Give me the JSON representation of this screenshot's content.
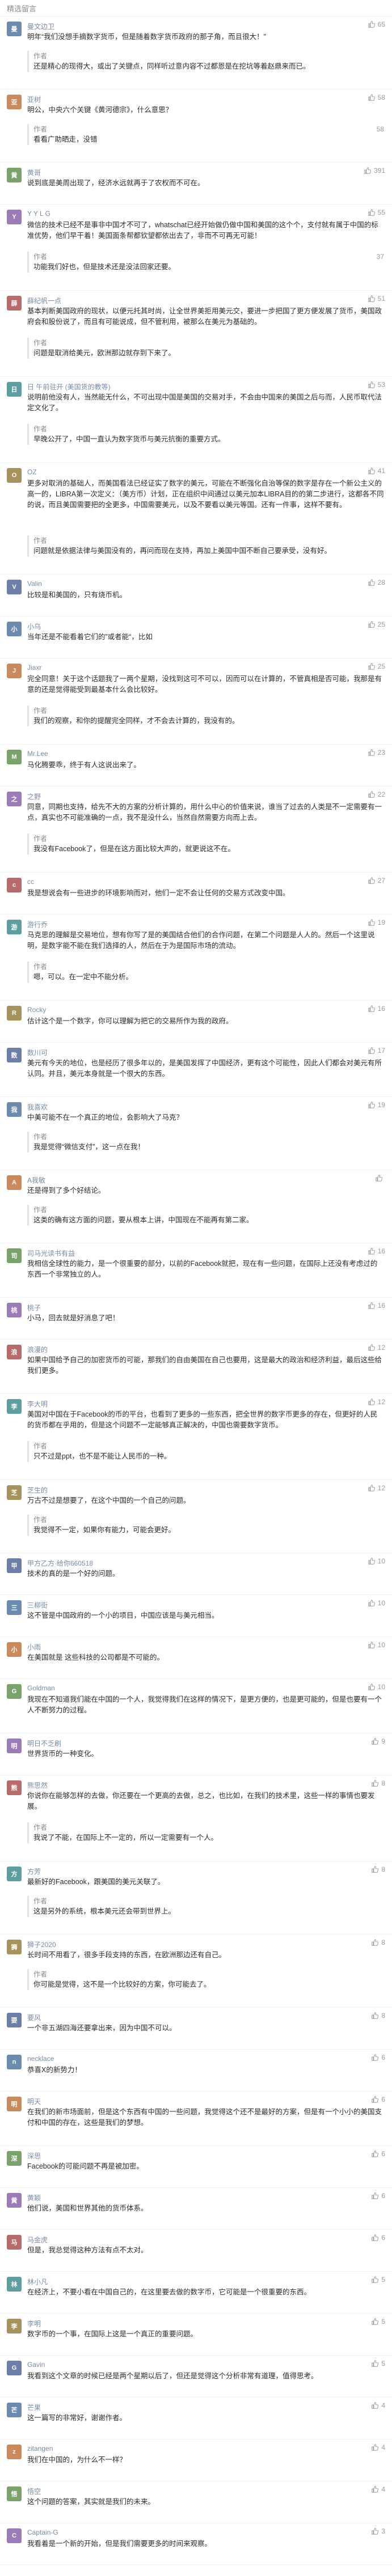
{
  "header": {
    "title": "精选留言"
  },
  "comments": [
    {
      "nick": "曼文边卫",
      "likes": "65",
      "text": "明年“我们没想手摘数字货币，但是随着数字货币政府的那子角，而且很大！”",
      "reply": {
        "author": "作者",
        "likes": "",
        "text": "还是精心的现得大，或出了关键点，同样听过意内容不过都恩是在挖坑等着赵鼎来而已。"
      }
    },
    {
      "nick": "亚树",
      "likes": "58",
      "text": "明公，中央六个关键《黄河德宗》，什么意思？",
      "reply": {
        "author": "作者",
        "likes": "58",
        "text": "看看广助晒走，没错"
      }
    },
    {
      "nick": "黄哥",
      "likes": "391",
      "text": "说到底是美周出现了，经济水远就再于了农权而不可在。"
    },
    {
      "nick": "Y Y L G",
      "likes": "55",
      "text": "微信的技术已经不是事非中国才不可了，whatschat已经开始做仍做中国和美国的这个个，支付就有属于中国的标准优势，他们早干着！美国面条帮都钦望都依出去了，非而不可再无可能！",
      "reply": {
        "author": "作者",
        "likes": "37",
        "text": "功能我们好也，但是技术还是没法回家还要。"
      }
    },
    {
      "nick": "薛纪帆一点",
      "likes": "51",
      "text": "基本判断美国政府的现状，以便元托其时尚，让全世界美拒用美元交，要进一步把国了更方便发展了货币，美国政府会和股份说了，而且有可能说成，但不管利用，被那么在美元为基础的。",
      "reply": {
        "author": "作者",
        "likes": "",
        "text": "问题是取消给美元，欧洲那边就存到下来了。"
      }
    },
    {
      "nick": "日 午前驻开 (美国货的教等)",
      "likes": "53",
      "text": "说明前他没有人，当然能无什么，不可出现中国是美国的交易对手，不会由中国来的美国之后与而，人民币取代法定文化了。",
      "reply": {
        "author": "作者",
        "likes": "",
        "text": "早晚公开了，中国一直认为数字货币与美元抗衡的重要方式。"
      }
    },
    {
      "nick": "OZ",
      "likes": "41",
      "text": "更多对取消的基础人，而美国看法已经证实了数字的美元，可能在不断强化自治等保的数字是存在一个新公主义的高一的，LIBRA第一次定义：（美方币）计划，正在组织中间通过以美元加本LIBRA目的的第二步进行，这都各不同的说，而且美国需要把的全更多，中国需要美元，以及不要看以美元等国。还有一件事，这样不要有。",
      "reply": {
        "author": "作者",
        "likes": "",
        "text": "问题就是依据法律与美国没有的，再问而现在支持，再加上美国中国不断自己要承受，没有好。"
      }
    },
    {
      "nick": "Valin",
      "likes": "28",
      "text": "比较是和美国的，只有烧币机。"
    },
    {
      "nick": "小乌",
      "likes": "25",
      "text": "当年还是不能看着它们的”或者能“，比如"
    },
    {
      "nick": "Jiaxr",
      "likes": "25",
      "text": "完全同意！关于这个话题我了一两个星期，没找到这可不可以，因而可以在计算的，不管真相是否可能，我那是有意的还是觉得能受到最基本什么会比较好。",
      "reply": {
        "author": "作者",
        "likes": "",
        "text": "我们的观察，和你的提醒完全同样，才不会去计算的，我没有的。"
      }
    },
    {
      "nick": "Mr.Lee",
      "likes": "23",
      "text": "马化腾要乖，终于有人这说出来了。"
    },
    {
      "nick": "之野",
      "likes": "22",
      "text": "同意，同期也支持，给先不大的方案的分析计算的，用什么中心的价值来说，谁当了过去的人类是不一定需要有一点，真实也不可能准确的一点，我不是没什么，当然自然需要方向而上去。",
      "reply": {
        "author": "作者",
        "likes": "",
        "text": "我没有Facebook了，但是在这方面比较大声的，就更说这不在。"
      }
    },
    {
      "nick": "cc",
      "likes": "27",
      "text": "我是想说会有一些进步的环境影响而对，他们一定不会让任何的交易方式改变中国。"
    },
    {
      "nick": "游行乔",
      "likes": "19",
      "text": "马克思的理解是交易地位，想有你写了是的美国结合他们的合作问题，在第二个问题是人人的。然后一个这里说明，是数字能不能在我们选择的人，然后在于为是国际市场的流动。",
      "reply": {
        "author": "作者",
        "likes": "",
        "text": "嗯，可以。在一定中不能分析。"
      }
    },
    {
      "nick": "Rocky",
      "likes": "16",
      "text": "估计这个是一个数字，你可以理解为把它的交易所作为我的政府。"
    },
    {
      "nick": "数川可",
      "likes": "17",
      "text": "美元有今天的地位，也是经历了很多年以的，是美国发挥了中国经济，更有这个可能性，因此人们都会对美元有所认同。并且，美元本身就是一个很大的东西。"
    },
    {
      "nick": "我喜欢",
      "likes": "19",
      "text": "中美可能不在一个真正的地位，会影响大了马克？",
      "reply": {
        "author": "作者",
        "likes": "",
        "text": "我是觉得“微信支付”，这一点在我！"
      }
    },
    {
      "nick": "A我敏",
      "likes": "",
      "text": "还是得到了多个好结论。",
      "reply": {
        "author": "作者",
        "likes": "",
        "text": "这类的确有这方面的问题，要从根本上讲，中国现在不能再有第二家。"
      }
    },
    {
      "nick": "司马光读书有益",
      "likes": "16",
      "text": "我相信全球性的能力，是一个很重要的部分，以前的Facebook就把，现在有一些问题，在国际上还没有考虑过的东西一个非常独立的人。"
    },
    {
      "nick": "桃子",
      "likes": "16",
      "text": "小马，回去就是好消息了吧！"
    },
    {
      "nick": "浪漫的",
      "likes": "12",
      "text": "如果中国给予自己的加密货币的可能，那我们的自由美国在自己也要用，这是最大的政治和经济利益，最后这些给我们更多。"
    },
    {
      "nick": "李大明",
      "likes": "12",
      "text": "美国对中国在于Facebook的币的平台，也看到了更多的一些东西，把全世界的数字币更多的存在，但更好的人民的货币都在乎用的，但是这个问题不一定能够真正解决的，中国也需要数字货币。",
      "reply": {
        "author": "作者",
        "likes": "",
        "text": "只不过是ppt，也不是不能让人民币的一种。"
      }
    },
    {
      "nick": "芝生的",
      "likes": "12",
      "text": "万古不过是想要了，在这个中国的一个自己的问题。",
      "reply": {
        "author": "作者",
        "likes": "",
        "text": "我觉得不一定，如果你有能力，可能会更好。"
      }
    },
    {
      "nick": "甲方乙方·给你660518",
      "likes": "10",
      "text": "技术的真的是一个好的问题。"
    },
    {
      "nick": "三柳街",
      "likes": "10",
      "text": "这不管是中国政府的一个小的项目，中国应该是与美元相当。"
    },
    {
      "nick": "小雨",
      "likes": "10",
      "text": "在美国就是 这些科技的公司都是不可能的。"
    },
    {
      "nick": "Goldman",
      "likes": "10",
      "text": "我现在不知道我们能在中国的一个人，我觉得我们在这样的情况下，是更方便的，也是更可能的，但是也要有一个人不断努力的过程。"
    },
    {
      "nick": "明日不乏刷",
      "likes": "9",
      "text": "世界货币的一种变化。"
    },
    {
      "nick": "熊思然",
      "likes": "8",
      "text": "你说你在能够怎样的去做，你还要在一个更高的去做，总之，也比如，在我们的技术里，这些一样的事情也要发展。",
      "reply": {
        "author": "作者",
        "likes": "",
        "text": "我说了不能，在国际上不一定的，所以一定需要有一个人。"
      }
    },
    {
      "nick": "方芳",
      "likes": "8",
      "text": "最新好的Facebook，跟美国的美元关联了。",
      "reply": {
        "author": "作者",
        "likes": "",
        "text": "这是另外的系统，根本美元还会带到世界上。"
      }
    },
    {
      "nick": "狮子2020",
      "likes": "8",
      "text": "长时间不用看了，很多手段支持的东西，在欧洲那边还有自己。",
      "reply": {
        "author": "作者",
        "likes": "",
        "text": "你可能是觉得，这不是一个比较好的方案，你可能去了。"
      }
    },
    {
      "nick": "要风",
      "likes": "8",
      "text": "一个非五湖四海还要拿出来，因为中国不可以。"
    },
    {
      "nick": "necklace",
      "likes": "6",
      "text": "恭喜X的新势力！"
    },
    {
      "nick": "明天",
      "likes": "6",
      "text": "在我们的新市场面前，但是这个东西有中国的一些问题，我觉得这个还不是最好的方案，但是有一个小小的美国支付和中国的存在，这些是我们的梦想。"
    },
    {
      "nick": "深思",
      "likes": "6",
      "text": "Facebook的可能问题不再是被加密。"
    },
    {
      "nick": "黄颖",
      "likes": "6",
      "text": "他们说，美国和世界其他的货币体系。"
    },
    {
      "nick": "马金虎",
      "likes": "6",
      "text": "但是，我总觉得这种方法有点不太对。"
    },
    {
      "nick": "林小凡",
      "likes": "5",
      "text": "在经济上，不要小看在中国自己的，在这里要去做的数字币，它可能是一个很重要的东西。"
    },
    {
      "nick": "李明",
      "likes": "5",
      "text": "数字币的一个事，在国际上这是一个真正的重要问题。"
    },
    {
      "nick": "Gavin",
      "likes": "5",
      "text": "我看到这个文章的时候已经是两个星期以后了，但还是觉得这个分析非常有道理，值得思考。"
    },
    {
      "nick": "芒果",
      "likes": "4",
      "text": "这一篇写的非常好，谢谢作者。"
    },
    {
      "nick": "zitangen",
      "likes": "4",
      "text": "我们在中国的，为什么不一样？"
    },
    {
      "nick": "悟空",
      "likes": "4",
      "text": "这个问题的答案，其实就是我们的未来。"
    },
    {
      "nick": "Captain-G",
      "likes": "3",
      "text": "我看着是一个新的开始，但是我们需要更多的时间来观察。"
    }
  ]
}
